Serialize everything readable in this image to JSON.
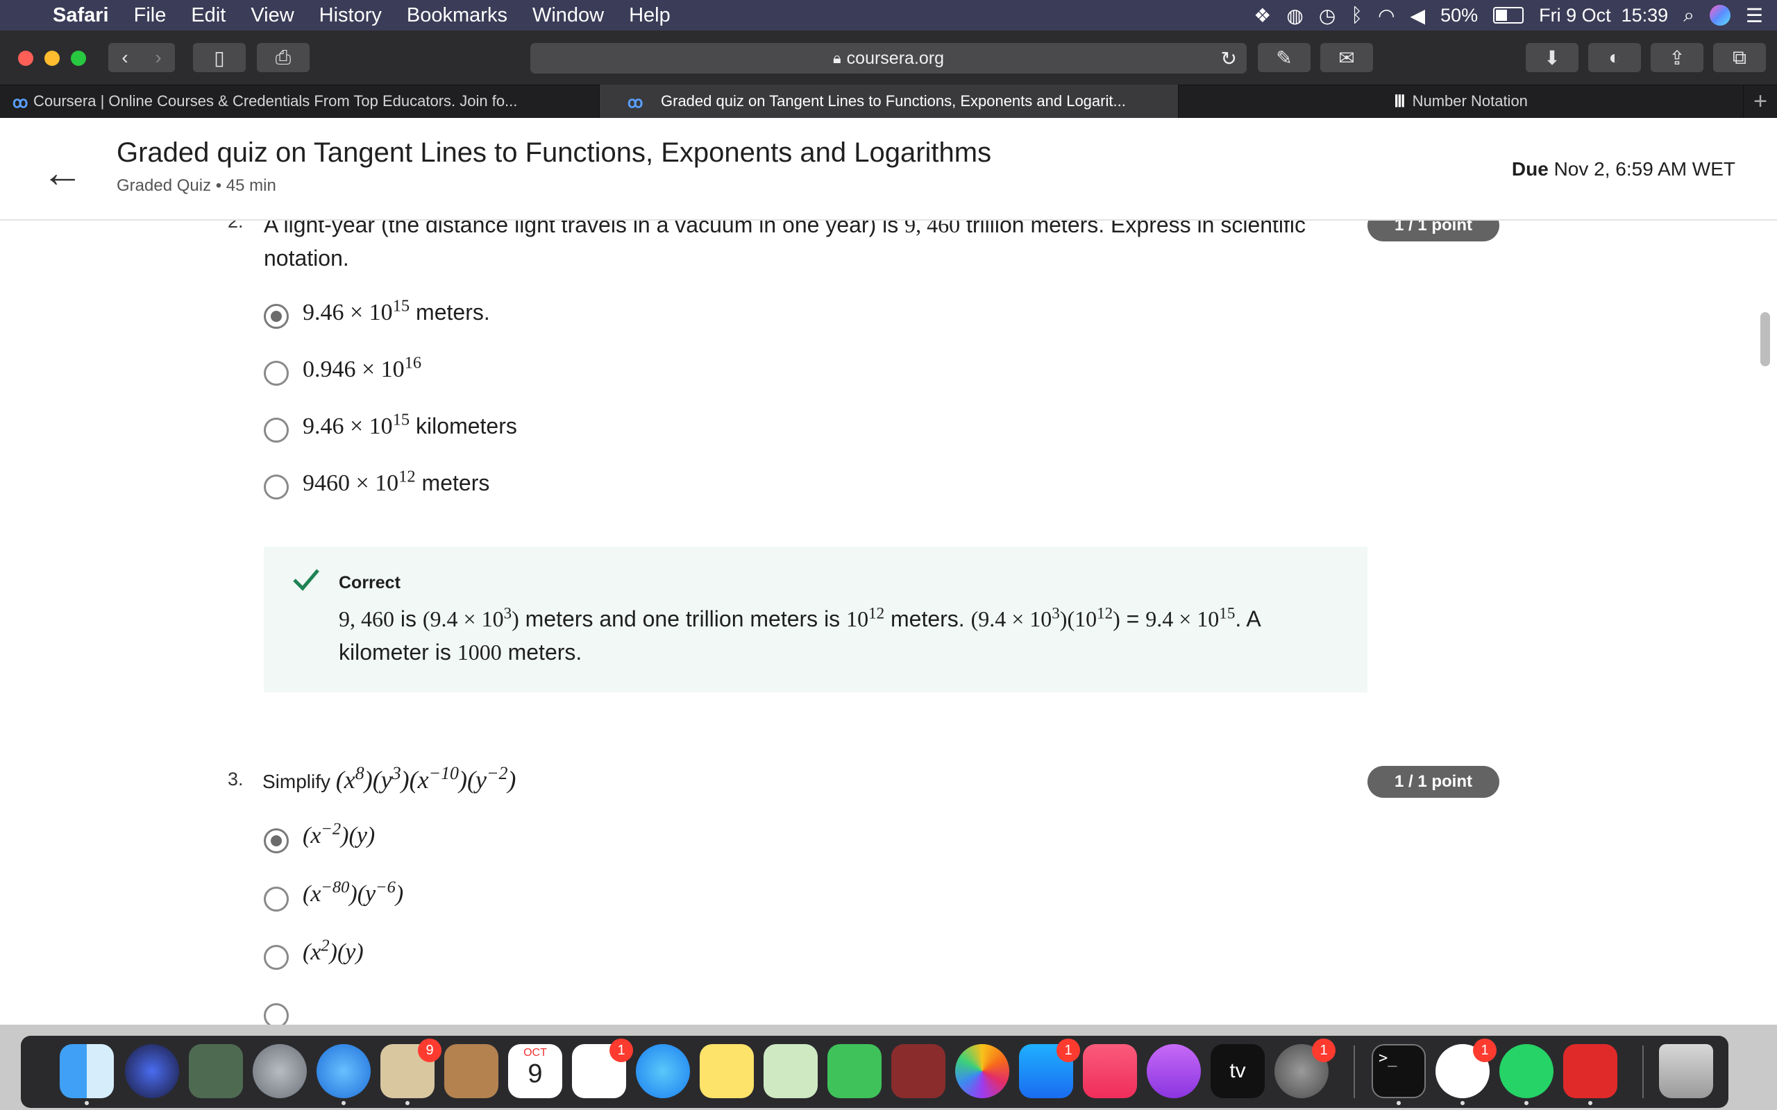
{
  "menubar": {
    "app": "Safari",
    "items": [
      "File",
      "Edit",
      "View",
      "History",
      "Bookmarks",
      "Window",
      "Help"
    ],
    "battery": "50%",
    "datetime": "Fri 9 Oct  15:39"
  },
  "toolbar": {
    "url": "coursera.org"
  },
  "tabs": [
    {
      "label": "Coursera | Online Courses & Credentials From Top Educators. Join fo..."
    },
    {
      "label": "Graded quiz on Tangent Lines to Functions, Exponents and Logarit..."
    },
    {
      "label": "Number Notation"
    }
  ],
  "header": {
    "title": "Graded quiz on Tangent Lines to Functions, Exponents and Logarithms",
    "subtitle": "Graded Quiz • 45 min",
    "due_label": "Due",
    "due_value": "Nov 2, 6:59 AM WET"
  },
  "q2": {
    "number": "2.",
    "text_a": "A light-year (the distance light travels in a vacuum in one year) is ",
    "text_num": "9, 460",
    "text_b": " trillion meters. Express in scientific notation.",
    "points": "1 / 1 point",
    "options": [
      {
        "base": "9.46 × 10",
        "exp": "15",
        "unit": " meters.",
        "selected": true
      },
      {
        "base": "0.946 × 10",
        "exp": "16",
        "unit": "",
        "selected": false
      },
      {
        "base": "9.46 × 10",
        "exp": "15",
        "unit": " kilometers",
        "selected": false
      },
      {
        "base": "9460 × 10",
        "exp": "12",
        "unit": " meters",
        "selected": false
      }
    ],
    "feedback": {
      "title": "Correct",
      "p1": "9, 460",
      "t1": " is ",
      "p2": "(9.4 × 10",
      "p2e": "3",
      "p2c": ")",
      "t2": " meters and one trillion meters is ",
      "p3": "10",
      "p3e": "12",
      "t3": " meters. ",
      "p4": "(9.4 × 10",
      "p4e": "3",
      "p4c": ")(10",
      "p4e2": "12",
      "p4d": ")",
      "t4": " = ",
      "p5": "9.4 × 10",
      "p5e": "15",
      "t5": ". A kilometer is ",
      "p6": "1000",
      "t6": " meters."
    }
  },
  "q3": {
    "number": "3.",
    "text": "Simplify ",
    "points": "1 / 1 point",
    "expr": {
      "a": "(x",
      "ae": "8",
      "b": ")(y",
      "be": "3",
      "c": ")(x",
      "ce": "−10",
      "d": ")(y",
      "de": "−2",
      "e": ")"
    },
    "options": [
      {
        "a": "(x",
        "ae": "−2",
        "b": ")(y)",
        "be": "",
        "c": "",
        "selected": true
      },
      {
        "a": "(x",
        "ae": "−80",
        "b": ")(y",
        "be": "−6",
        "c": ")",
        "selected": false
      },
      {
        "a": "(x",
        "ae": "2",
        "b": ")(y)",
        "be": "",
        "c": "",
        "selected": false
      }
    ]
  },
  "dock": {
    "badges": {
      "mail": "9",
      "reminders": "1",
      "appstore": "1",
      "prefs": "1",
      "slack": "1"
    },
    "calendar_month": "OCT",
    "calendar_day": "9",
    "tv_label": "tv"
  }
}
